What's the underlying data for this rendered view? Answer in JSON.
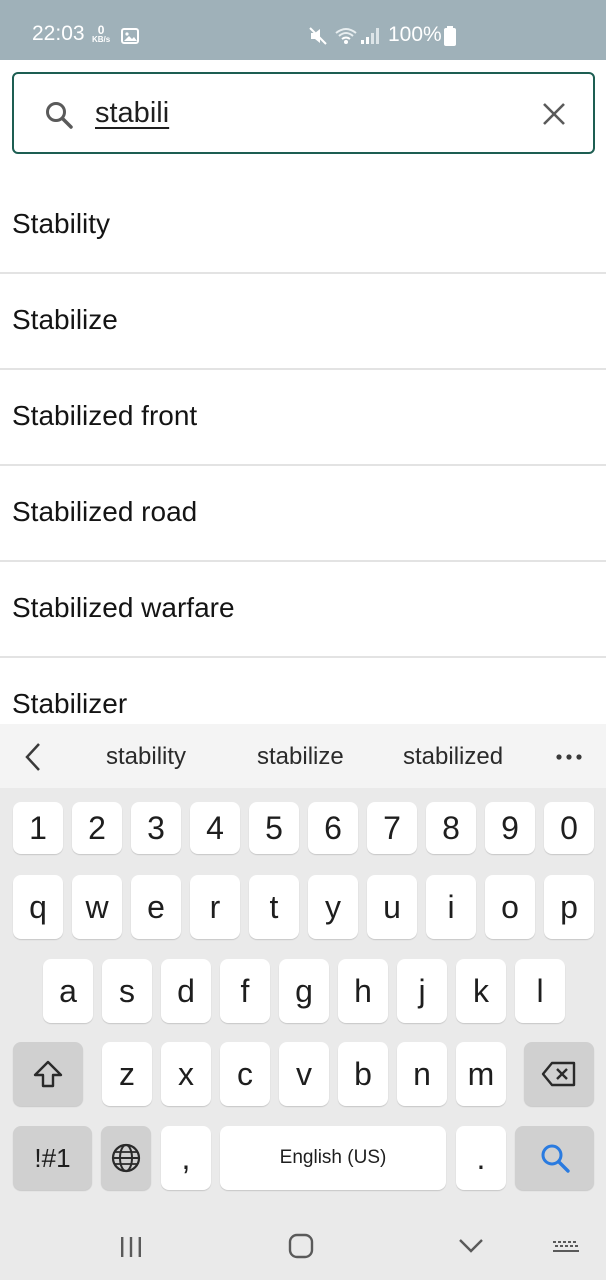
{
  "status_bar": {
    "time": "22:03",
    "speed_value": "0",
    "speed_unit": "KB/s",
    "battery": "100%"
  },
  "search": {
    "query": "stabili"
  },
  "suggestions": [
    "Stability",
    "Stabilize",
    "Stabilized front",
    "Stabilized road",
    "Stabilized warfare",
    "Stabilizer"
  ],
  "keyboard": {
    "predictions": [
      "stability",
      "stabilize",
      "stabilized"
    ],
    "row_numbers": [
      "1",
      "2",
      "3",
      "4",
      "5",
      "6",
      "7",
      "8",
      "9",
      "0"
    ],
    "row_top": [
      "q",
      "w",
      "e",
      "r",
      "t",
      "y",
      "u",
      "i",
      "o",
      "p"
    ],
    "row_middle": [
      "a",
      "s",
      "d",
      "f",
      "g",
      "h",
      "j",
      "k",
      "l"
    ],
    "row_bottom": [
      "z",
      "x",
      "c",
      "v",
      "b",
      "n",
      "m"
    ],
    "symbols_label": "!#1",
    "comma": ",",
    "space_label": "English (US)",
    "period": "."
  },
  "colors": {
    "status_bar_bg": "#9fb1b9",
    "search_border": "#1d5e52",
    "search_key_icon": "#2a7be0"
  }
}
